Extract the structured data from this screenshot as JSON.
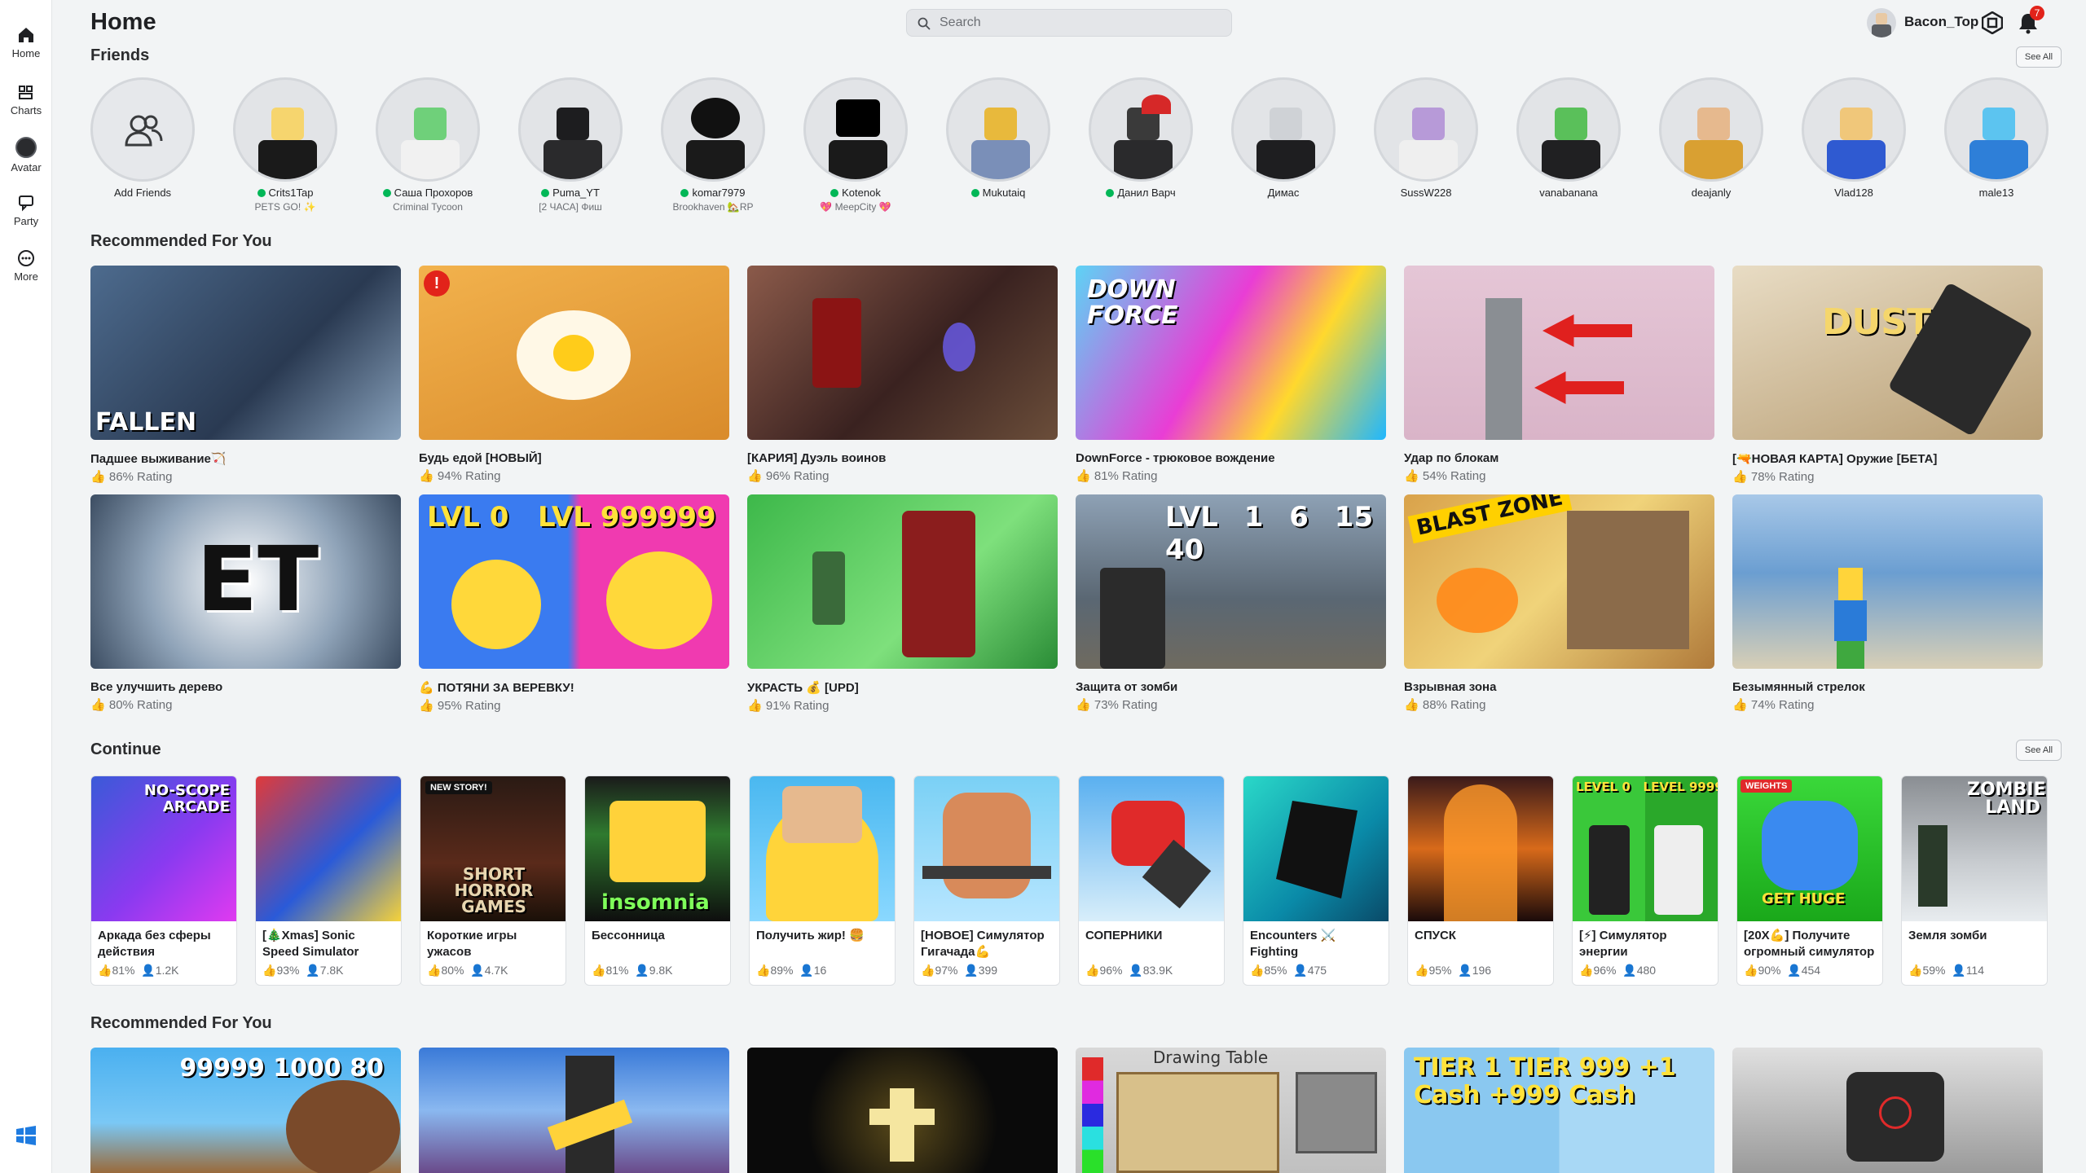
{
  "nav": {
    "items": [
      {
        "label": "Home"
      },
      {
        "label": "Charts"
      },
      {
        "label": "Avatar"
      },
      {
        "label": "Party"
      },
      {
        "label": "More"
      }
    ]
  },
  "header": {
    "title": "Home",
    "search_placeholder": "Search",
    "username": "Bacon_Top",
    "notification_count": "7"
  },
  "friends": {
    "title": "Friends",
    "see_all": "See All",
    "list": [
      {
        "name": "Add Friends",
        "status": "",
        "online": false
      },
      {
        "name": "Crits1Tap",
        "status": "PETS GO! ✨",
        "online": true
      },
      {
        "name": "Саша Прохоров",
        "status": "Criminal Tycoon",
        "online": true
      },
      {
        "name": "Puma_YT",
        "status": "[2 ЧАСА] Фиш",
        "online": true
      },
      {
        "name": "komar7979",
        "status": "Brookhaven 🏡RP",
        "online": true
      },
      {
        "name": "Kotenok",
        "status": "💖 MeepCity 💖",
        "online": true
      },
      {
        "name": "Mukutaiq",
        "status": "",
        "online": true
      },
      {
        "name": "Данил Варч",
        "status": "",
        "online": true
      },
      {
        "name": "Димас",
        "status": "",
        "online": false
      },
      {
        "name": "SussW228",
        "status": "",
        "online": false
      },
      {
        "name": "vanabanana",
        "status": "",
        "online": false
      },
      {
        "name": "deajanly",
        "status": "",
        "online": false
      },
      {
        "name": "Vlad128",
        "status": "",
        "online": false
      },
      {
        "name": "male13",
        "status": "",
        "online": false
      }
    ]
  },
  "recommended": {
    "title": "Recommended For You",
    "games": [
      {
        "name": "Падшее выживание🏹",
        "rating": "86% Rating",
        "thumb_text": "FALLEN"
      },
      {
        "name": "Будь едой [НОВЫЙ]",
        "rating": "94% Rating",
        "thumb_text": ""
      },
      {
        "name": "[КАРИЯ] Дуэль воинов",
        "rating": "96% Rating",
        "thumb_text": ""
      },
      {
        "name": "DownForce - трюковое вождение",
        "rating": "81% Rating",
        "thumb_text": "DOWN FORCE"
      },
      {
        "name": "Удар по блокам",
        "rating": "54% Rating",
        "thumb_text": ""
      },
      {
        "name": "[🔫НОВАЯ КАРТА] Оружие [БЕТА]",
        "rating": "78% Rating",
        "thumb_text": "DUST"
      },
      {
        "name": "Все улучшить дерево",
        "rating": "80% Rating",
        "thumb_text": "ET"
      },
      {
        "name": "💪 ПОТЯНИ ЗА ВЕРЕВКУ!",
        "rating": "95% Rating",
        "thumb_text": "LVL 0   LVL 999999"
      },
      {
        "name": "УКРАСТЬ 💰 [UPD]",
        "rating": "91% Rating",
        "thumb_text": ""
      },
      {
        "name": "Защита от зомби",
        "rating": "73% Rating",
        "thumb_text": "LVL 1  6  15  40"
      },
      {
        "name": "Взрывная зона",
        "rating": "88% Rating",
        "thumb_text": "BLAST ZONE"
      },
      {
        "name": "Безымянный стрелок",
        "rating": "74% Rating",
        "thumb_text": ""
      }
    ]
  },
  "continue": {
    "title": "Continue",
    "see_all": "See All",
    "games": [
      {
        "name": "Аркада без сферы действия",
        "rating": "81%",
        "players": "1.2K",
        "thumb_text": "NO-SCOPE ARCADE"
      },
      {
        "name": "[🎄Xmas] Sonic Speed Simulator",
        "rating": "93%",
        "players": "7.8K",
        "thumb_text": ""
      },
      {
        "name": "Короткие игры ужасов",
        "rating": "80%",
        "players": "4.7K",
        "thumb_text": "SHORT HORROR GAMES"
      },
      {
        "name": "Бессонница",
        "rating": "81%",
        "players": "9.8K",
        "thumb_text": "insomnia"
      },
      {
        "name": "Получить жир! 🍔",
        "rating": "89%",
        "players": "16",
        "thumb_text": ""
      },
      {
        "name": "[НОВОЕ] Симулятор Гигачада💪",
        "rating": "97%",
        "players": "399",
        "thumb_text": ""
      },
      {
        "name": "СОПЕРНИКИ",
        "rating": "96%",
        "players": "83.9K",
        "thumb_text": ""
      },
      {
        "name": "Encounters ⚔️ Fighting",
        "rating": "85%",
        "players": "475",
        "thumb_text": ""
      },
      {
        "name": "СПУСК",
        "rating": "95%",
        "players": "196",
        "thumb_text": ""
      },
      {
        "name": "[⚡] Симулятор энергии",
        "rating": "96%",
        "players": "480",
        "thumb_text": "LEVEL 0   LEVEL 9999"
      },
      {
        "name": "[20X💪] Получите огромный симулятор",
        "rating": "90%",
        "players": "454",
        "thumb_text": "GET HUGE"
      },
      {
        "name": "Земля зомби",
        "rating": "59%",
        "players": "114",
        "thumb_text": "ZOMBIE LAND"
      }
    ],
    "badges": [
      "NEW STORY!",
      "WEIGHTS"
    ]
  },
  "recommended2": {
    "title": "Recommended For You",
    "thumb_texts": [
      "99999  1000  80",
      "",
      "",
      "Drawing Table",
      "TIER 1   TIER 999  +1 Cash  +999 Cash",
      ""
    ]
  },
  "colors": {
    "accent_online": "#02b757",
    "notification": "#e2231a",
    "background": "#f2f4f5"
  }
}
